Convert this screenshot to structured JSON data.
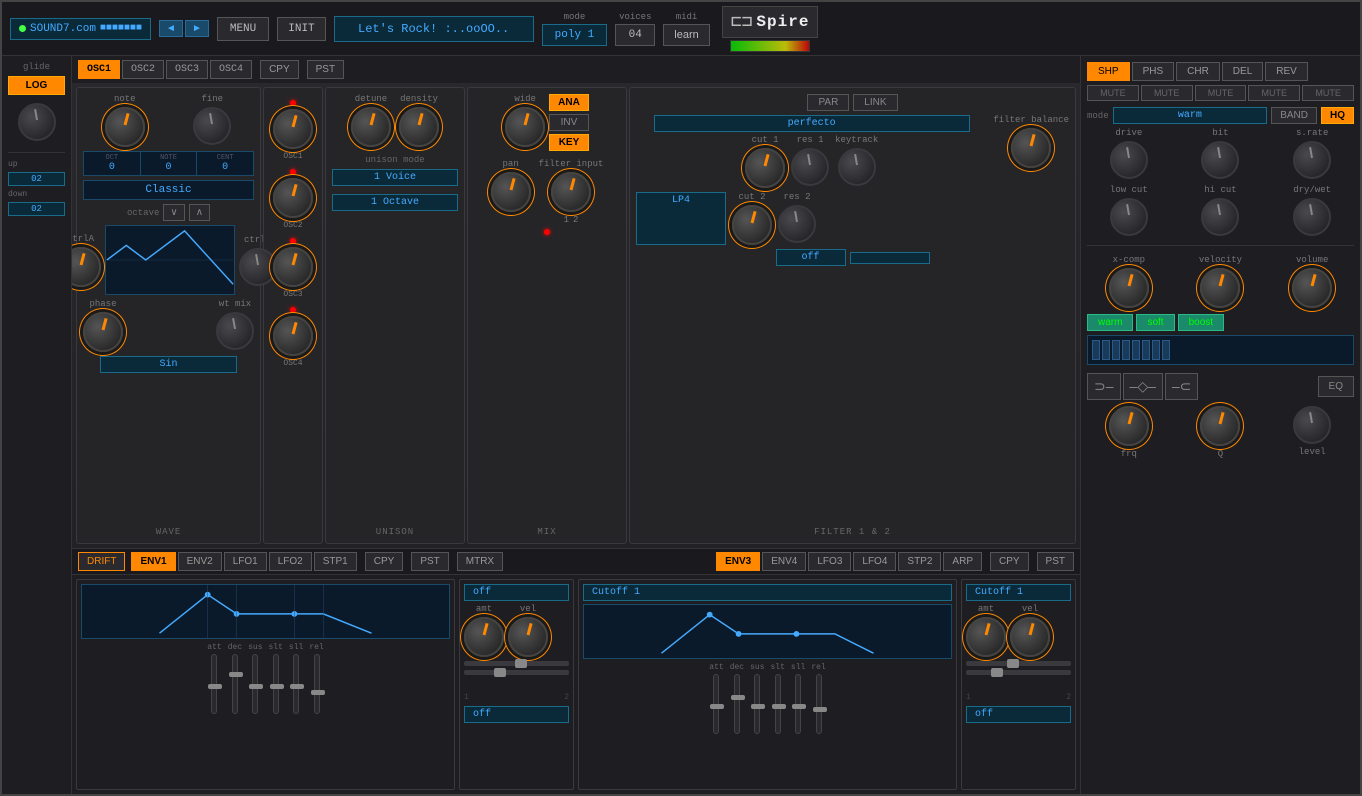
{
  "header": {
    "website": "SOUND7.com",
    "menu_label": "MENU",
    "init_label": "INIT",
    "preset_name": "Let's Rock! :..ooOO..",
    "mode_label": "mode",
    "mode_value": "poly 1",
    "voices_label": "voices",
    "voices_value": "04",
    "midi_label": "midi",
    "midi_learn": "learn",
    "brand": "Spire"
  },
  "osc_tabs": {
    "tabs": [
      "OSC1",
      "OSC2",
      "OSC3",
      "OSC4"
    ],
    "active": "OSC1",
    "copy": "CPY",
    "paste": "PST"
  },
  "wave_section": {
    "label": "WAVE",
    "note_label": "note",
    "mode_value": "Classic",
    "fine_label": "fine",
    "octave_label": "octave",
    "ctrla_label": "ctrlA",
    "ctrlb_label": "ctrlB",
    "phase_label": "phase",
    "wtmix_label": "wt mix",
    "wave_type": "Sin",
    "note_vals": [
      "0",
      "0",
      "0"
    ],
    "note_keys": [
      "OCT",
      "NOTE",
      "CENT"
    ]
  },
  "unison_section": {
    "label": "UNISON",
    "detune_label": "detune",
    "density_label": "density",
    "mode_label": "unison mode",
    "mode_value": "1 Voice",
    "octave_value": "1 Octave"
  },
  "mix_section": {
    "label": "MIX",
    "wide_label": "wide",
    "pan_label": "pan",
    "filter_input_label": "filter input",
    "ana_label": "ANA",
    "inv_label": "INV",
    "key_label": "KEY"
  },
  "filter_section": {
    "label": "FILTER 1 & 2",
    "par_label": "PAR",
    "link_label": "LINK",
    "filter1_label": "perfecto",
    "filter2_label": "LP4",
    "cut1_label": "cut 1",
    "res1_label": "res 1",
    "keytrack_label": "keytrack",
    "cut2_label": "cut 2",
    "res2_label": "res 2",
    "filter_balance_label": "filter balance",
    "off_label": "off"
  },
  "fx_section": {
    "tabs": [
      "SHP",
      "PHS",
      "CHR",
      "DEL",
      "REV"
    ],
    "active": "SHP",
    "mute_labels": [
      "MUTE",
      "MUTE",
      "MUTE",
      "MUTE",
      "MUTE"
    ],
    "mode_label": "mode",
    "warm_label": "warm",
    "band_label": "BAND",
    "hq_label": "HQ",
    "drive_label": "drive",
    "bit_label": "bit",
    "srate_label": "s.rate",
    "lowcut_label": "low cut",
    "hicut_label": "hi cut",
    "drywet_label": "dry/wet"
  },
  "env1": {
    "header": "ENV1",
    "sliders": [
      "att",
      "dec",
      "sus",
      "slt",
      "sll",
      "rel"
    ]
  },
  "lfo1": {
    "header": "off",
    "amt_label": "amt",
    "vel_label": "vel"
  },
  "env3": {
    "header": "Cutoff 1",
    "sliders": [
      "att",
      "dec",
      "sus",
      "slt",
      "sll",
      "rel"
    ],
    "amt_label": "amt",
    "vel_label": "vel"
  },
  "master_section": {
    "xcomp_label": "x-comp",
    "velocity_label": "velocity",
    "volume_label": "volume",
    "warm_label": "warm",
    "soft_label": "soft",
    "boost_label": "boost",
    "frq_label": "frq",
    "q_label": "Q",
    "level_label": "level",
    "eq_label": "EQ"
  },
  "bottom_tabs": {
    "left": [
      "DRIFT",
      "ENV1",
      "ENV2",
      "LFO1",
      "LFO2",
      "STP1",
      "CPY",
      "PST",
      "MTRX"
    ],
    "right": [
      "ENV3",
      "ENV4",
      "LFO3",
      "LFO4",
      "STP2",
      "ARP",
      "CPY",
      "PST"
    ],
    "active_left": "ENV1",
    "active_right": "ENV3"
  },
  "bender": {
    "up_label": "up",
    "down_label": "down",
    "up_val": "02",
    "down_val": "02",
    "glide_label": "glide",
    "log_label": "LOG"
  },
  "colors": {
    "orange": "#f80",
    "teal": "#4af",
    "bg_dark": "#1a1a1e",
    "accent_green": "#0f0"
  }
}
